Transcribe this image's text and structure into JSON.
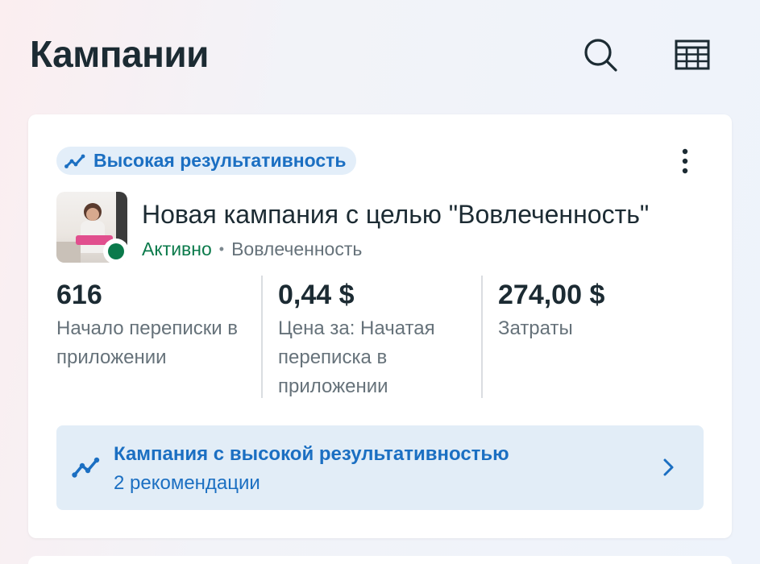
{
  "header": {
    "title": "Кампании",
    "icons": [
      "search-icon",
      "table-icon"
    ]
  },
  "campaign_card": {
    "badge": {
      "icon": "trend-up-icon",
      "label": "Высокая результативность"
    },
    "more_icon": "more-vertical-icon",
    "thumbnail_status_color": "#0b7a4b",
    "name": "Новая кампания с целью \"Вовлеченность\"",
    "status": "Активно",
    "separator": "•",
    "objective": "Вовлеченность",
    "metrics": [
      {
        "value": "616",
        "label": "Начало переписки в приложении"
      },
      {
        "value": "0,44 $",
        "label": "Цена за: Начатая переписка в приложении"
      },
      {
        "value": "274,00 $",
        "label": "Затраты"
      }
    ],
    "recommendation": {
      "icon": "trend-up-icon",
      "title": "Кампания с высокой результативностью",
      "subtitle": "2 рекомендации",
      "chevron": "chevron-right-icon"
    }
  },
  "colors": {
    "accent": "#1b6fc2",
    "active_green": "#0b7a4b",
    "text_primary": "#1c2b33",
    "text_secondary": "#66727a",
    "badge_bg": "#e3eef9",
    "reco_bg": "#e2edf7"
  }
}
